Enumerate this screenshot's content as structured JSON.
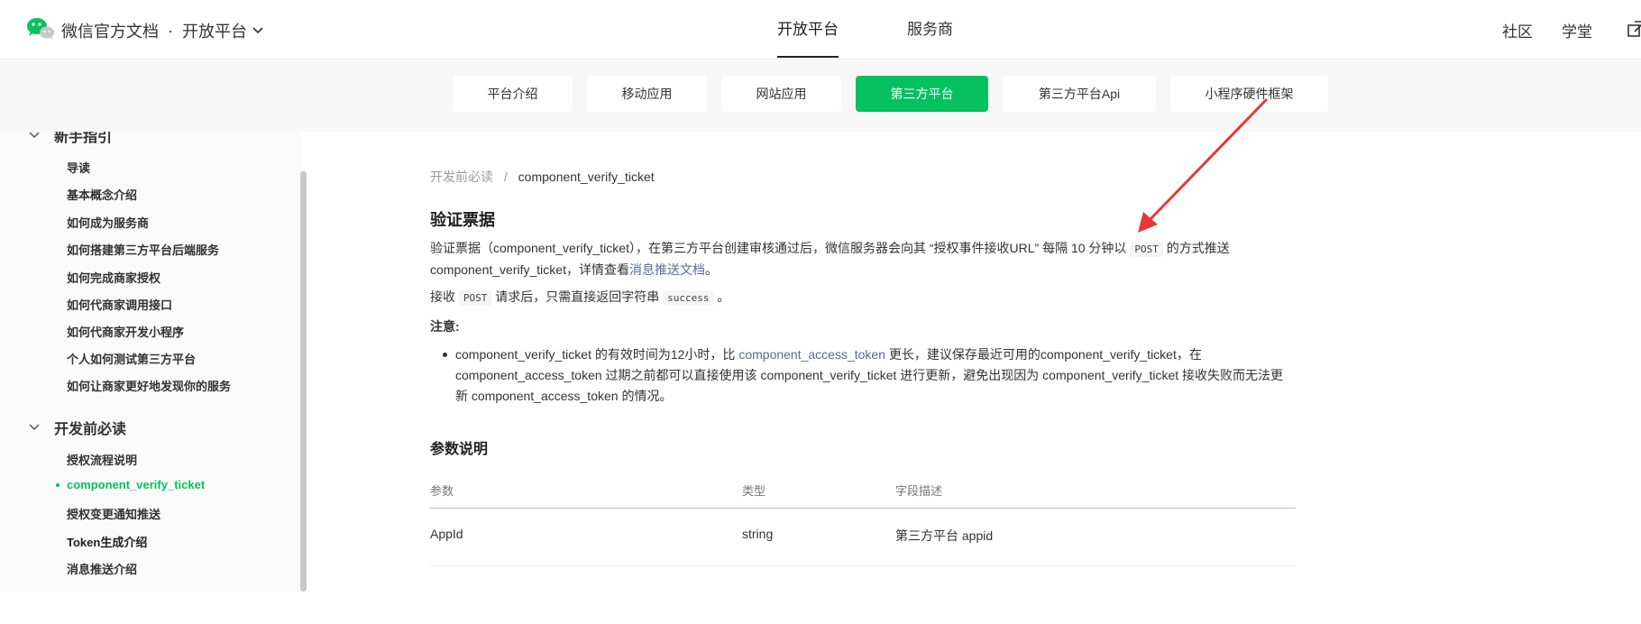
{
  "header": {
    "brand": "微信官方文档",
    "brand_sep": "·",
    "platform": "开放平台",
    "platform_chevron": "chevron-down",
    "top_nav": [
      "开放平台",
      "服务商"
    ],
    "active_top_nav": "开放平台",
    "right_nav": [
      "社区",
      "学堂"
    ],
    "right_icon": "external-link-icon"
  },
  "subnav": {
    "tabs": [
      "平台介绍",
      "移动应用",
      "网站应用",
      "第三方平台",
      "第三方平台Api",
      "小程序硬件框架"
    ],
    "active": "第三方平台"
  },
  "sidebar": {
    "group1": {
      "label": "新手指引",
      "items": [
        "导读",
        "基本概念介绍",
        "如何成为服务商",
        "如何搭建第三方平台后端服务",
        "如何完成商家授权",
        "如何代商家调用接口",
        "如何代商家开发小程序",
        "个人如何测试第三方平台",
        "如何让商家更好地发现你的服务"
      ]
    },
    "group2": {
      "label": "开发前必读",
      "items": [
        "授权流程说明",
        "component_verify_ticket",
        "授权变更通知推送",
        "Token生成介绍",
        "消息推送介绍"
      ]
    },
    "active_item": "component_verify_ticket"
  },
  "main": {
    "breadcrumb": {
      "parent": "开发前必读",
      "sep": "/",
      "current": "component_verify_ticket"
    },
    "title": "验证票据",
    "p1_a": "验证票据（component_verify_ticket），在第三方平台创建审核通过后，微信服务器会向其 “授权事件接收URL” 每隔 10 分钟以",
    "p1_code": "POST",
    "p1_b": "的方式推送",
    "p1_c": "component_verify_ticket，详情查看",
    "p1_link": "消息推送文档",
    "p1_end": "。",
    "p2_a": "接收",
    "p2_code1": "POST",
    "p2_b": "请求后，只需直接返回字符串",
    "p2_code2": "success",
    "p2_end": "。",
    "note_label": "注意:",
    "bullet_a": "component_verify_ticket 的有效时间为12小时，比",
    "bullet_link": "component_access_token",
    "bullet_b": "更长，建议保存最近可用的component_verify_ticket，在 component_access_token 过期之前都可以直接使用该 component_verify_ticket 进行更新，避免出现因为 component_verify_ticket 接收失败而无法更新 component_access_token 的情况。",
    "section_title": "参数说明",
    "table": {
      "headers": [
        "参数",
        "类型",
        "字段描述"
      ],
      "rows": [
        [
          "AppId",
          "string",
          "第三方平台 appid"
        ]
      ]
    }
  },
  "colors": {
    "brand_green": "#07c160",
    "link_blue": "#576b95",
    "annotation_red": "#e53935"
  }
}
